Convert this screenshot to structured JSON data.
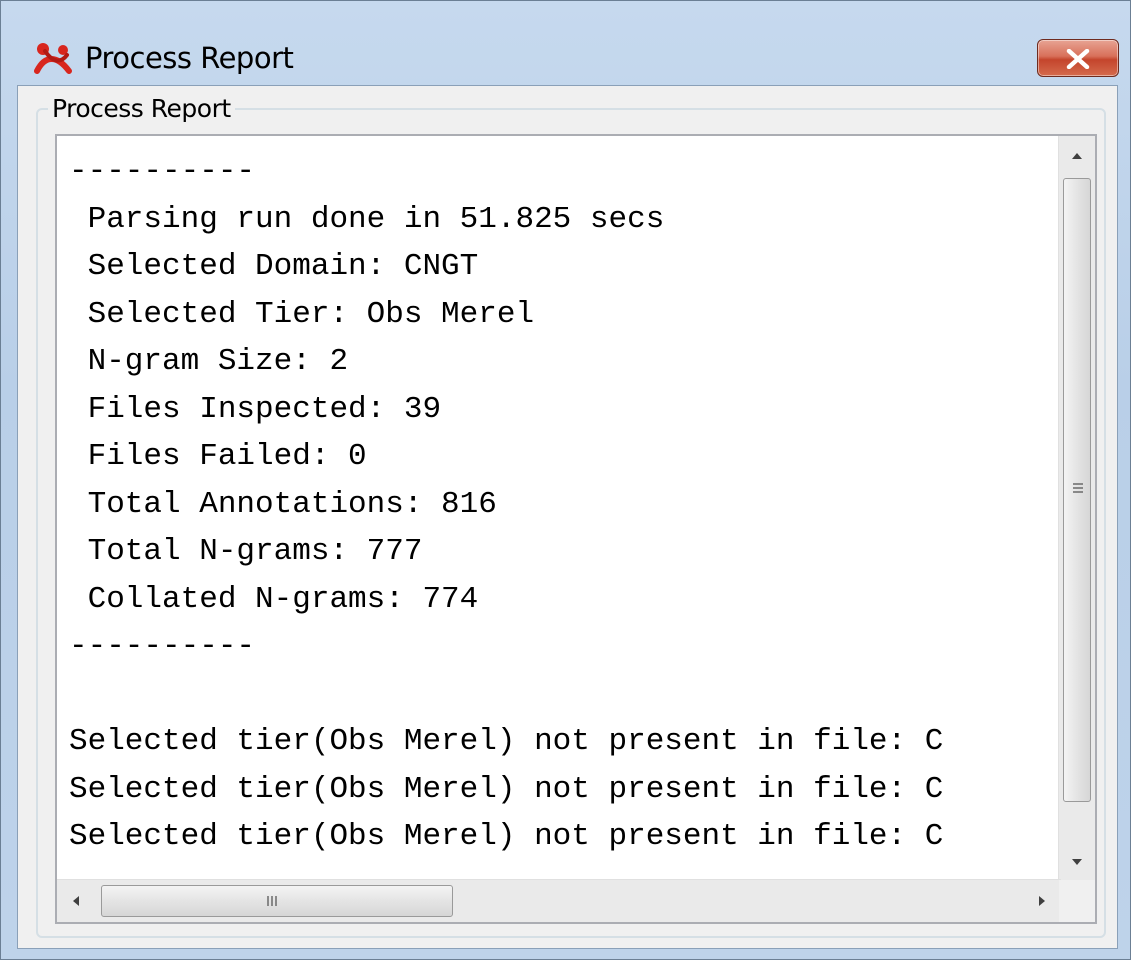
{
  "window": {
    "title": "Process Report",
    "icon": "app-logo-icon",
    "close_icon": "close-icon"
  },
  "group": {
    "legend": "Process Report"
  },
  "report": {
    "lines": [
      "----------",
      " Parsing run done in 51.825 secs",
      " Selected Domain: CNGT",
      " Selected Tier: Obs Merel",
      " N-gram Size: 2",
      " Files Inspected: 39",
      " Files Failed: 0",
      " Total Annotations: 816",
      " Total N-grams: 777",
      " Collated N-grams: 774",
      "----------",
      "",
      "Selected tier(Obs Merel) not present in file: C",
      "Selected tier(Obs Merel) not present in file: C",
      "Selected tier(Obs Merel) not present in file: C"
    ]
  },
  "scrollbars": {
    "vertical_position": 0.0,
    "horizontal_position": 0.0
  },
  "colors": {
    "close_button": "#c4452c",
    "title_bar": "#c6d9ee"
  }
}
